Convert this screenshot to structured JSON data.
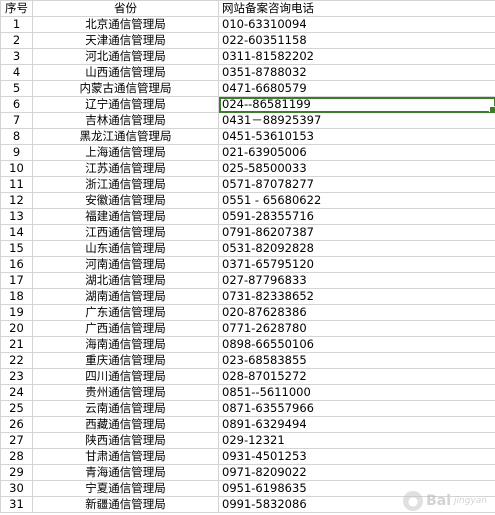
{
  "headers": {
    "index": "序号",
    "province": "省份",
    "phone": "网站备案咨询电话"
  },
  "rows": [
    {
      "index": "1",
      "province": "北京通信管理局",
      "phone": "010-63310094"
    },
    {
      "index": "2",
      "province": "天津通信管理局",
      "phone": "022-60351158"
    },
    {
      "index": "3",
      "province": "河北通信管理局",
      "phone": "0311-81582202"
    },
    {
      "index": "4",
      "province": "山西通信管理局",
      "phone": "0351-8788032"
    },
    {
      "index": "5",
      "province": "内蒙古通信管理局",
      "phone": "0471-6680579"
    },
    {
      "index": "6",
      "province": "辽宁通信管理局",
      "phone": "024--86581199"
    },
    {
      "index": "7",
      "province": "吉林通信管理局",
      "phone": "0431－88925397"
    },
    {
      "index": "8",
      "province": "黑龙江通信管理局",
      "phone": "0451-53610153"
    },
    {
      "index": "9",
      "province": "上海通信管理局",
      "phone": "021-63905006"
    },
    {
      "index": "10",
      "province": "江苏通信管理局",
      "phone": "025-58500033"
    },
    {
      "index": "11",
      "province": "浙江通信管理局",
      "phone": "0571-87078277"
    },
    {
      "index": "12",
      "province": "安徽通信管理局",
      "phone": "0551 - 65680622"
    },
    {
      "index": "13",
      "province": "福建通信管理局",
      "phone": "0591-28355716"
    },
    {
      "index": "14",
      "province": "江西通信管理局",
      "phone": "0791-86207387"
    },
    {
      "index": "15",
      "province": "山东通信管理局",
      "phone": "0531-82092828"
    },
    {
      "index": "16",
      "province": "河南通信管理局",
      "phone": "0371-65795120"
    },
    {
      "index": "17",
      "province": "湖北通信管理局",
      "phone": "027-87796833"
    },
    {
      "index": "18",
      "province": "湖南通信管理局",
      "phone": "0731-82338652"
    },
    {
      "index": "19",
      "province": "广东通信管理局",
      "phone": "020-87628386"
    },
    {
      "index": "20",
      "province": "广西通信管理局",
      "phone": "0771-2628780"
    },
    {
      "index": "21",
      "province": "海南通信管理局",
      "phone": "0898-66550106"
    },
    {
      "index": "22",
      "province": "重庆通信管理局",
      "phone": "023-68583855"
    },
    {
      "index": "23",
      "province": "四川通信管理局",
      "phone": "028-87015272"
    },
    {
      "index": "24",
      "province": "贵州通信管理局",
      "phone": "0851--5611000"
    },
    {
      "index": "25",
      "province": "云南通信管理局",
      "phone": "0871-63557966"
    },
    {
      "index": "26",
      "province": "西藏通信管理局",
      "phone": "0891-6329494"
    },
    {
      "index": "27",
      "province": "陕西通信管理局",
      "phone": "029-12321"
    },
    {
      "index": "28",
      "province": "甘肃通信管理局",
      "phone": "0931-4501253"
    },
    {
      "index": "29",
      "province": "青海通信管理局",
      "phone": "0971-8209022"
    },
    {
      "index": "30",
      "province": "宁夏通信管理局",
      "phone": "0951-6198635"
    },
    {
      "index": "31",
      "province": "新疆通信管理局",
      "phone": "0991-5832086"
    }
  ],
  "selected_row": 6,
  "colors": {
    "gridline": "#d4d4d4",
    "selection": "#3c7d2a"
  },
  "watermark": {
    "icon": "baidu-paw-icon",
    "text": "Bai",
    "sub": "jingyan"
  }
}
